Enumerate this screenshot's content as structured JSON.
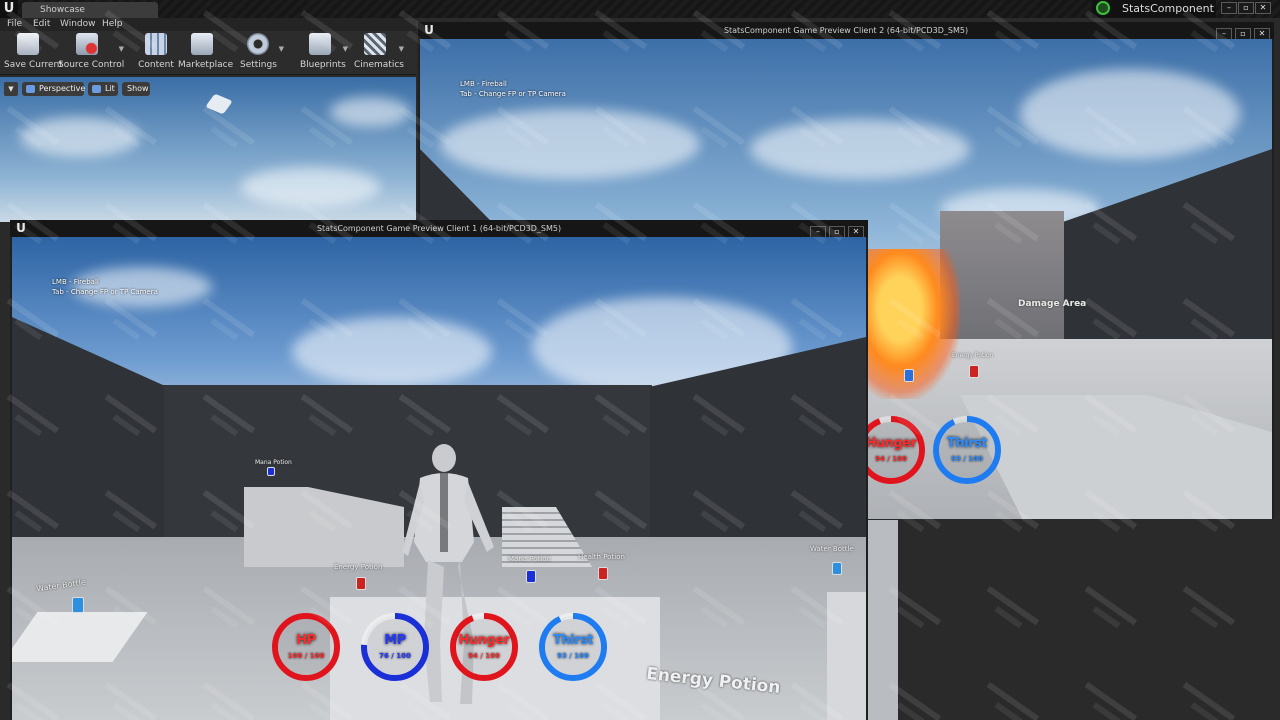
{
  "editor": {
    "level_tab": "Showcase",
    "project_name": "StatsComponent",
    "menu": [
      "File",
      "Edit",
      "Window",
      "Help"
    ],
    "toolbar": [
      {
        "label": "Save Current",
        "icon": "save-icon"
      },
      {
        "label": "Source Control",
        "icon": "source-control-icon"
      },
      {
        "label": "Content",
        "icon": "content-icon"
      },
      {
        "label": "Marketplace",
        "icon": "marketplace-icon"
      },
      {
        "label": "Settings",
        "icon": "settings-icon"
      },
      {
        "label": "Blueprints",
        "icon": "blueprints-icon"
      },
      {
        "label": "Cinematics",
        "icon": "cinematics-icon"
      }
    ],
    "viewport": {
      "perspective": "Perspective",
      "lit": "Lit",
      "show": "Show"
    }
  },
  "client1": {
    "title": "StatsComponent Game Preview Client 1 (64-bit/PCD3D_SM5)",
    "hint_line1": "LMB - Fireball",
    "hint_line2": "Tab - Change FP or TP Camera",
    "world_labels": {
      "mana_top": "Mana Potion",
      "energy": "Energy Potion",
      "mana": "Mana Potion",
      "health": "Health Potion",
      "water_left": "Water Bottle",
      "water_right": "Water Bottle",
      "energy_big": "Energy Potion"
    },
    "stats": [
      {
        "name": "HP",
        "value": "100 / 100",
        "fill": 1.0,
        "color": "#e0141c",
        "text_color": "#ff2a2a"
      },
      {
        "name": "MP",
        "value": "76 / 100",
        "fill": 0.76,
        "color": "#1a2fd6",
        "text_color": "#2437ff"
      },
      {
        "name": "Hunger",
        "value": "94 / 100",
        "fill": 0.94,
        "color": "#e0141c",
        "text_color": "#ff2a2a"
      },
      {
        "name": "Thirst",
        "value": "93 / 100",
        "fill": 0.93,
        "color": "#1e7cf0",
        "text_color": "#2b8cff"
      }
    ]
  },
  "client2": {
    "title": "StatsComponent Game Preview Client 2 (64-bit/PCD3D_SM5)",
    "hint_line1": "LMB - Fireball",
    "hint_line2": "Tab - Change FP or TP Camera",
    "damage_area": "Damage Area",
    "energy_label": "Energy Potion",
    "stats": [
      {
        "name": "Hunger",
        "value": "94 / 100",
        "fill": 0.94,
        "color": "#e0141c",
        "text_color": "#ff2a2a"
      },
      {
        "name": "Thirst",
        "value": "93 / 100",
        "fill": 0.93,
        "color": "#1e7cf0",
        "text_color": "#2b8cff"
      }
    ]
  }
}
